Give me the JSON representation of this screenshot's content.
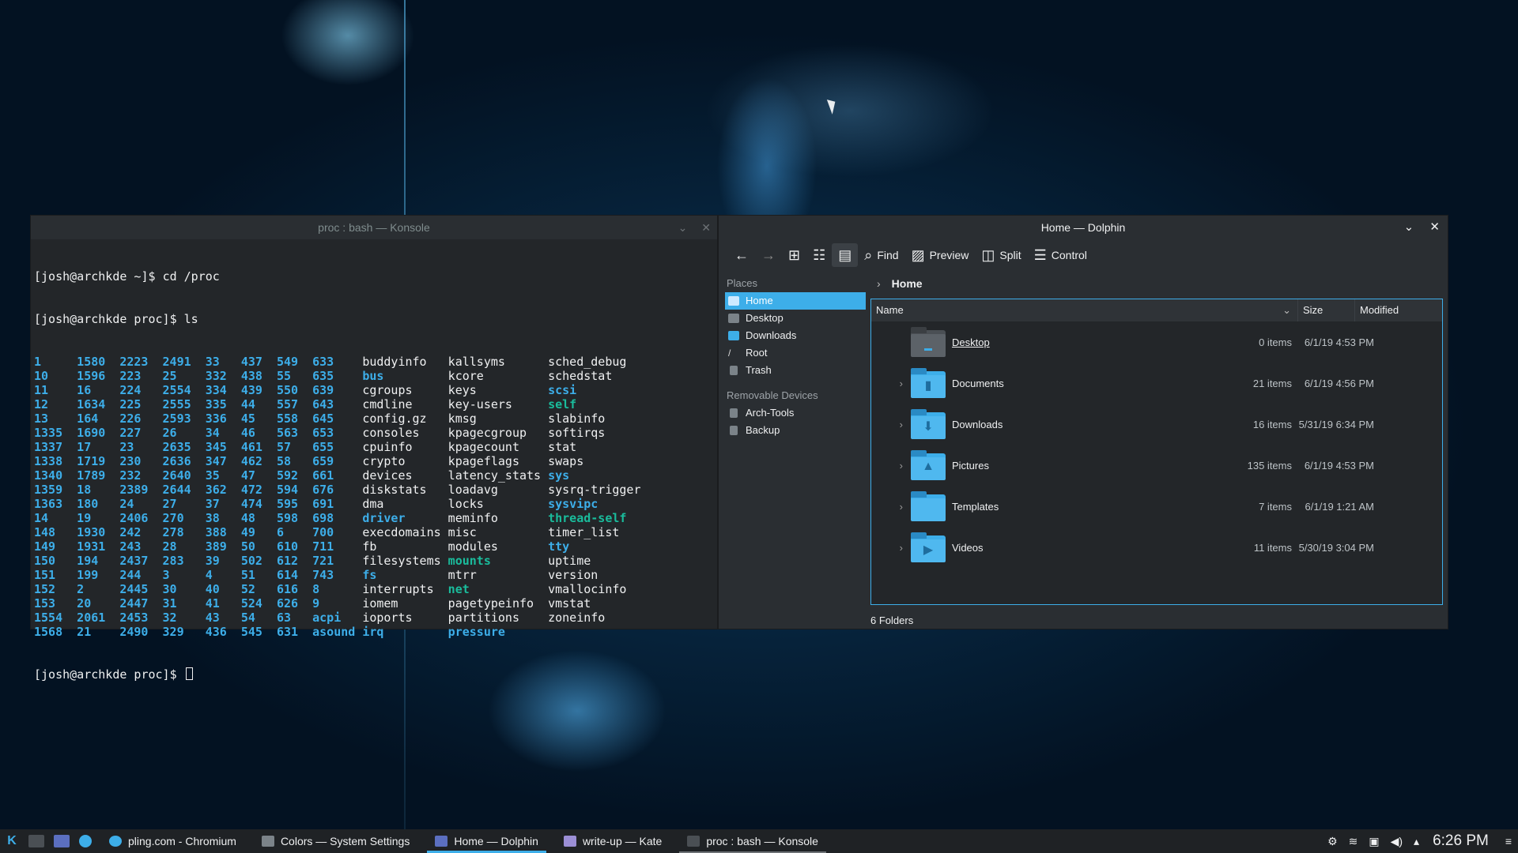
{
  "konsole": {
    "title": "proc : bash — Konsole",
    "lines": [
      {
        "prompt": "[josh@archkde ~]$ ",
        "cmd": "cd /proc"
      },
      {
        "prompt": "[josh@archkde proc]$ ",
        "cmd": "ls"
      }
    ],
    "ls_rows": [
      [
        "1",
        "1580",
        "2223",
        "2491",
        "33",
        "437",
        "549",
        "633",
        "buddyinfo",
        "kallsyms",
        "sched_debug"
      ],
      [
        "10",
        "1596",
        "223",
        "25",
        "332",
        "438",
        "55",
        "635",
        "bus",
        "kcore",
        "schedstat"
      ],
      [
        "11",
        "16",
        "224",
        "2554",
        "334",
        "439",
        "550",
        "639",
        "cgroups",
        "keys",
        "scsi"
      ],
      [
        "12",
        "1634",
        "225",
        "2555",
        "335",
        "44",
        "557",
        "643",
        "cmdline",
        "key-users",
        "self"
      ],
      [
        "13",
        "164",
        "226",
        "2593",
        "336",
        "45",
        "558",
        "645",
        "config.gz",
        "kmsg",
        "slabinfo"
      ],
      [
        "1335",
        "1690",
        "227",
        "26",
        "34",
        "46",
        "563",
        "653",
        "consoles",
        "kpagecgroup",
        "softirqs"
      ],
      [
        "1337",
        "17",
        "23",
        "2635",
        "345",
        "461",
        "57",
        "655",
        "cpuinfo",
        "kpagecount",
        "stat"
      ],
      [
        "1338",
        "1719",
        "230",
        "2636",
        "347",
        "462",
        "58",
        "659",
        "crypto",
        "kpageflags",
        "swaps"
      ],
      [
        "1340",
        "1789",
        "232",
        "2640",
        "35",
        "47",
        "592",
        "661",
        "devices",
        "latency_stats",
        "sys"
      ],
      [
        "1359",
        "18",
        "2389",
        "2644",
        "362",
        "472",
        "594",
        "676",
        "diskstats",
        "loadavg",
        "sysrq-trigger"
      ],
      [
        "1363",
        "180",
        "24",
        "27",
        "37",
        "474",
        "595",
        "691",
        "dma",
        "locks",
        "sysvipc"
      ],
      [
        "14",
        "19",
        "2406",
        "270",
        "38",
        "48",
        "598",
        "698",
        "driver",
        "meminfo",
        "thread-self"
      ],
      [
        "148",
        "1930",
        "242",
        "278",
        "388",
        "49",
        "6",
        "700",
        "execdomains",
        "misc",
        "timer_list"
      ],
      [
        "149",
        "1931",
        "243",
        "28",
        "389",
        "50",
        "610",
        "711",
        "fb",
        "modules",
        "tty"
      ],
      [
        "150",
        "194",
        "2437",
        "283",
        "39",
        "502",
        "612",
        "721",
        "filesystems",
        "mounts",
        "uptime"
      ],
      [
        "151",
        "199",
        "244",
        "3",
        "4",
        "51",
        "614",
        "743",
        "fs",
        "mtrr",
        "version"
      ],
      [
        "152",
        "2",
        "2445",
        "30",
        "40",
        "52",
        "616",
        "8",
        "interrupts",
        "net",
        "vmallocinfo"
      ],
      [
        "153",
        "20",
        "2447",
        "31",
        "41",
        "524",
        "626",
        "9",
        "iomem",
        "pagetypeinfo",
        "vmstat"
      ],
      [
        "1554",
        "2061",
        "2453",
        "32",
        "43",
        "54",
        "63",
        "acpi",
        "ioports",
        "partitions",
        "zoneinfo"
      ],
      [
        "1568",
        "21",
        "2490",
        "329",
        "436",
        "545",
        "631",
        "asound",
        "irq",
        "pressure",
        ""
      ]
    ],
    "dirs": [
      "bus",
      "scsi",
      "driver",
      "fs",
      "sys",
      "sysvipc",
      "tty",
      "acpi",
      "asound",
      "irq",
      "pressure"
    ],
    "links": [
      "self",
      "thread-self",
      "mounts",
      "net"
    ],
    "final_prompt": "[josh@archkde proc]$ "
  },
  "dolphin": {
    "title": "Home — Dolphin",
    "toolbar": {
      "find": "Find",
      "preview": "Preview",
      "split": "Split",
      "control": "Control"
    },
    "places_header": "Places",
    "places": [
      "Home",
      "Desktop",
      "Downloads",
      "Root",
      "Trash"
    ],
    "removable_header": "Removable Devices",
    "removable": [
      "Arch-Tools",
      "Backup"
    ],
    "breadcrumb": "Home",
    "columns": {
      "name": "Name",
      "size": "Size",
      "modified": "Modified"
    },
    "files": [
      {
        "name": "Desktop",
        "size": "0 items",
        "modified": "6/1/19 4:53 PM",
        "icon": "desktop-folder-icon",
        "expandable": false
      },
      {
        "name": "Documents",
        "size": "21 items",
        "modified": "6/1/19 4:56 PM",
        "icon": "documents-folder-icon",
        "expandable": true
      },
      {
        "name": "Downloads",
        "size": "16 items",
        "modified": "5/31/19 6:34 PM",
        "icon": "downloads-folder-icon",
        "expandable": true
      },
      {
        "name": "Pictures",
        "size": "135 items",
        "modified": "6/1/19 4:53 PM",
        "icon": "pictures-folder-icon",
        "expandable": true
      },
      {
        "name": "Templates",
        "size": "7 items",
        "modified": "6/1/19 1:21 AM",
        "icon": "templates-folder-icon",
        "expandable": true
      },
      {
        "name": "Videos",
        "size": "11 items",
        "modified": "5/30/19 3:04 PM",
        "icon": "videos-folder-icon",
        "expandable": true
      }
    ],
    "status": "6 Folders"
  },
  "taskbar": {
    "tasks": [
      {
        "label": "pling.com - Chromium",
        "state": "normal"
      },
      {
        "label": "Colors — System Settings",
        "state": "normal"
      },
      {
        "label": "Home — Dolphin",
        "state": "active"
      },
      {
        "label": "write-up — Kate",
        "state": "normal"
      },
      {
        "label": "proc : bash — Konsole",
        "state": "open"
      }
    ],
    "clock": "6:26 PM"
  },
  "colors": {
    "accent": "#3daee9",
    "link": "#1abc9c",
    "panel": "#1f2225",
    "window": "#2a2e32",
    "terminal_bg": "#232629"
  }
}
